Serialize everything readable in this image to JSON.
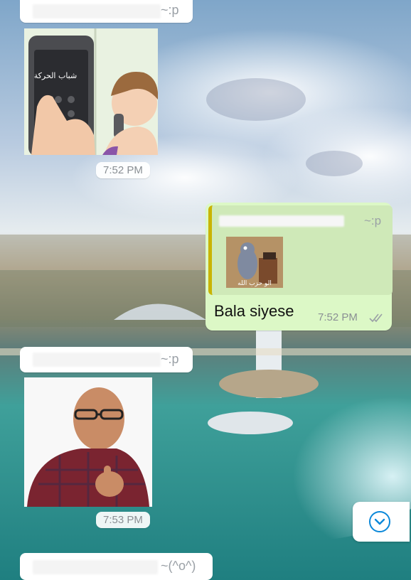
{
  "messages": {
    "m1": {
      "sender": "~:p",
      "kind": "image",
      "image": "sticker-man-phone-arabic-text",
      "image_text": "شباب الحركة",
      "time": "7:52 PM"
    },
    "m2": {
      "quoted_sender": "~:p",
      "quoted_image_text": "الو حزب الله",
      "text": "Bala siyese",
      "time": "7:52 PM",
      "status_icon": "double-check-icon"
    },
    "m3": {
      "sender": "~:p",
      "kind": "image",
      "image": "photo-man-thumbs-up",
      "time": "7:53 PM"
    },
    "m4": {
      "sender": "~(^o^)"
    }
  },
  "scroll_button": {
    "icon": "chevron-down-circle-icon"
  },
  "colors": {
    "incoming": "#ffffff",
    "outgoing": "#dcf8c6",
    "accent": "#0b88d9",
    "quote_bar": "#c9b400"
  }
}
